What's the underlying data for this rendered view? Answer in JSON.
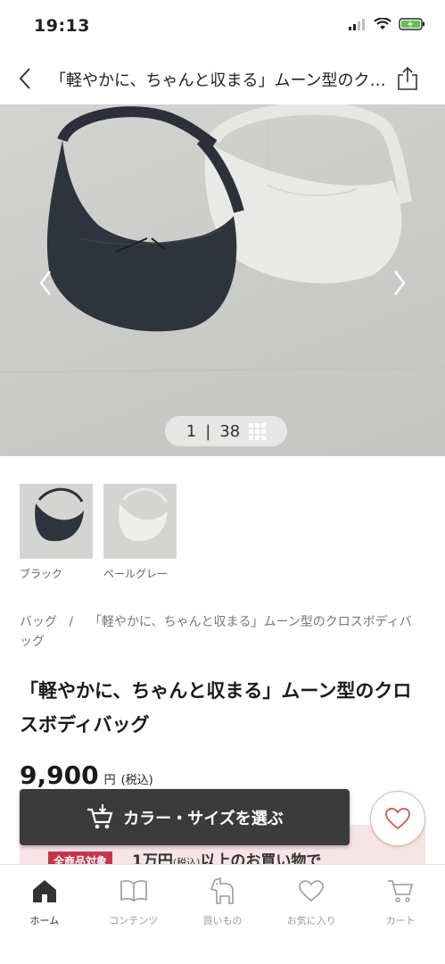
{
  "status_bar": {
    "time": "19:13"
  },
  "nav": {
    "title": "「軽やかに、ちゃんと収まる」ムーン型のクロスボディバッグ"
  },
  "gallery": {
    "current": "1",
    "separator": "|",
    "total": "38"
  },
  "swatches": [
    {
      "label": "ブラック"
    },
    {
      "label": "ペールグレー"
    }
  ],
  "breadcrumb": {
    "category": "バッグ",
    "separator": "/",
    "current": "「軽やかに、ちゃんと収まる」ムーン型のクロスボディバッグ"
  },
  "product": {
    "title": "「軽やかに、ちゃんと収まる」ムーン型のクロスボディバッグ",
    "price": "9,900",
    "price_unit": "円",
    "tax_note": "(税込)"
  },
  "cta": {
    "label": "カラー・サイズを選ぶ"
  },
  "promo": {
    "tag": "全商品対象",
    "amount": "1万円",
    "tax": "(税込)",
    "text": "以上のお買い物で"
  },
  "tabs": [
    {
      "label": "ホーム",
      "icon": "home-icon"
    },
    {
      "label": "コンテンツ",
      "icon": "book-icon"
    },
    {
      "label": "買いもの",
      "icon": "horse-icon"
    },
    {
      "label": "お気に入り",
      "icon": "heart-icon"
    },
    {
      "label": "カート",
      "icon": "cart-icon"
    }
  ],
  "colors": {
    "cta_bg": "#3b3b3b",
    "promo_tag": "#c7344b",
    "promo_bg": "#f7e4e6",
    "fav_border": "#e7b4ae"
  }
}
